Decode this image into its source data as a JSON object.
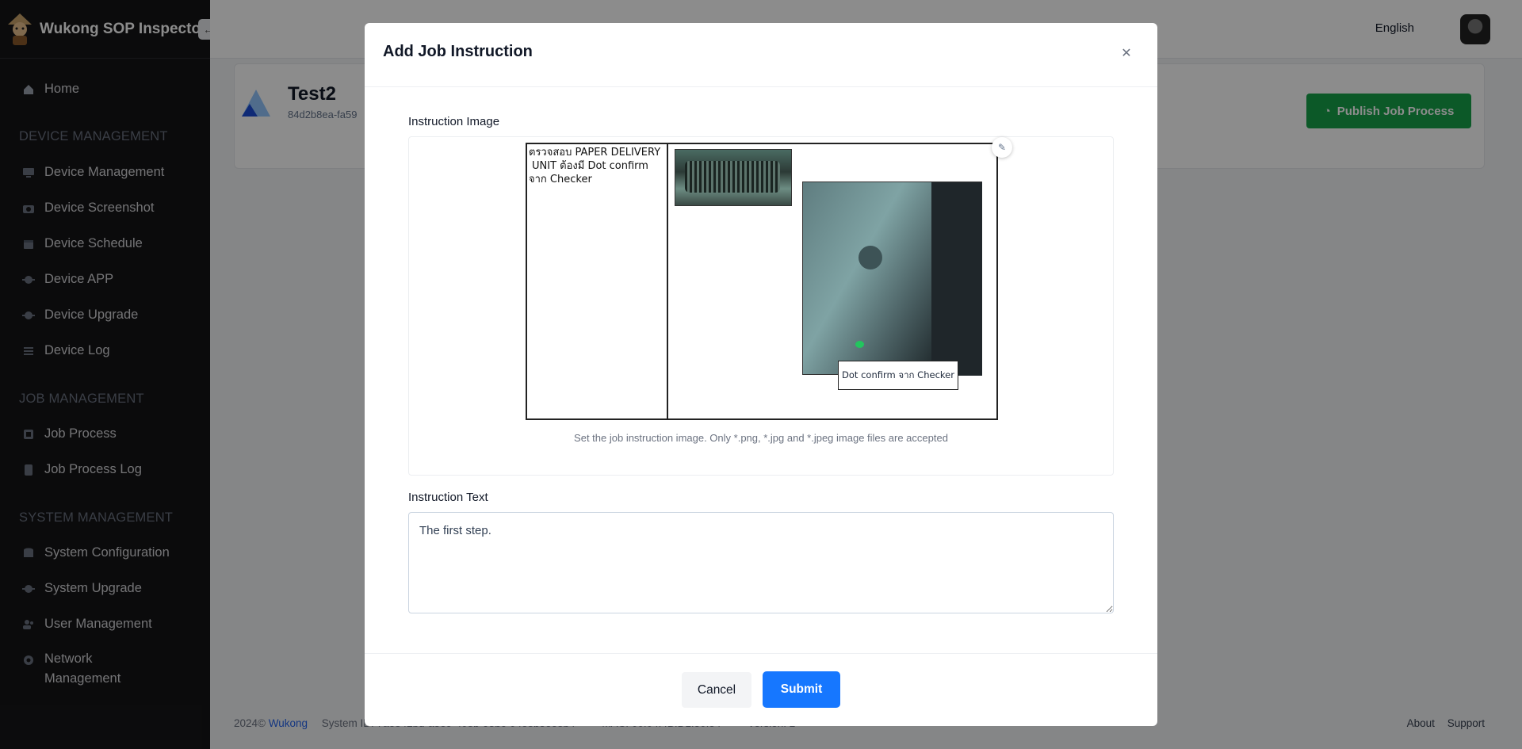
{
  "app": {
    "title": "Wukong SOP Inspector",
    "collapse_icon": "arrow-left-icon"
  },
  "sidebar": {
    "home": "Home",
    "sections": [
      {
        "title": "DEVICE MANAGEMENT",
        "items": [
          "Device Management",
          "Device Screenshot",
          "Device Schedule",
          "Device APP",
          "Device Upgrade",
          "Device Log"
        ]
      },
      {
        "title": "JOB MANAGEMENT",
        "items": [
          "Job Process",
          "Job Process Log"
        ]
      },
      {
        "title": "SYSTEM MANAGEMENT",
        "items": [
          "System Configuration",
          "System Upgrade",
          "User Management",
          "Network Management"
        ]
      }
    ]
  },
  "header": {
    "language": "English"
  },
  "job": {
    "name": "Test2",
    "id_prefix": "84d2b8ea-fa59",
    "publish_label": "Publish Job Process",
    "publish_color": "#16a34a"
  },
  "modal": {
    "title": "Add Job Instruction",
    "image_label": "Instruction Image",
    "image_hint": "Set the job instruction image. Only *.png, *.jpg and *.jpeg image files are accepted",
    "image_text_1": "ตรวจสอบ PAPER DELIVERY",
    "image_text_2": "UNIT ต้องมี Dot confirm",
    "image_text_3": "จาก Checker",
    "image_callout": "Dot confirm จาก Checker",
    "text_label": "Instruction Text",
    "text_value": "The first step.",
    "cancel_label": "Cancel",
    "submit_label": "Submit",
    "submit_color": "#1677ff"
  },
  "footer": {
    "year": "2024©",
    "brand": "Wukong",
    "system_id": "System ID: 7ae842bd-a5e9-408b-95bc-04e8b5ee8b4",
    "mac": "MAC: 00:04:4B:D1:50:54",
    "version": "Version: 2",
    "about": "About",
    "support": "Support"
  }
}
